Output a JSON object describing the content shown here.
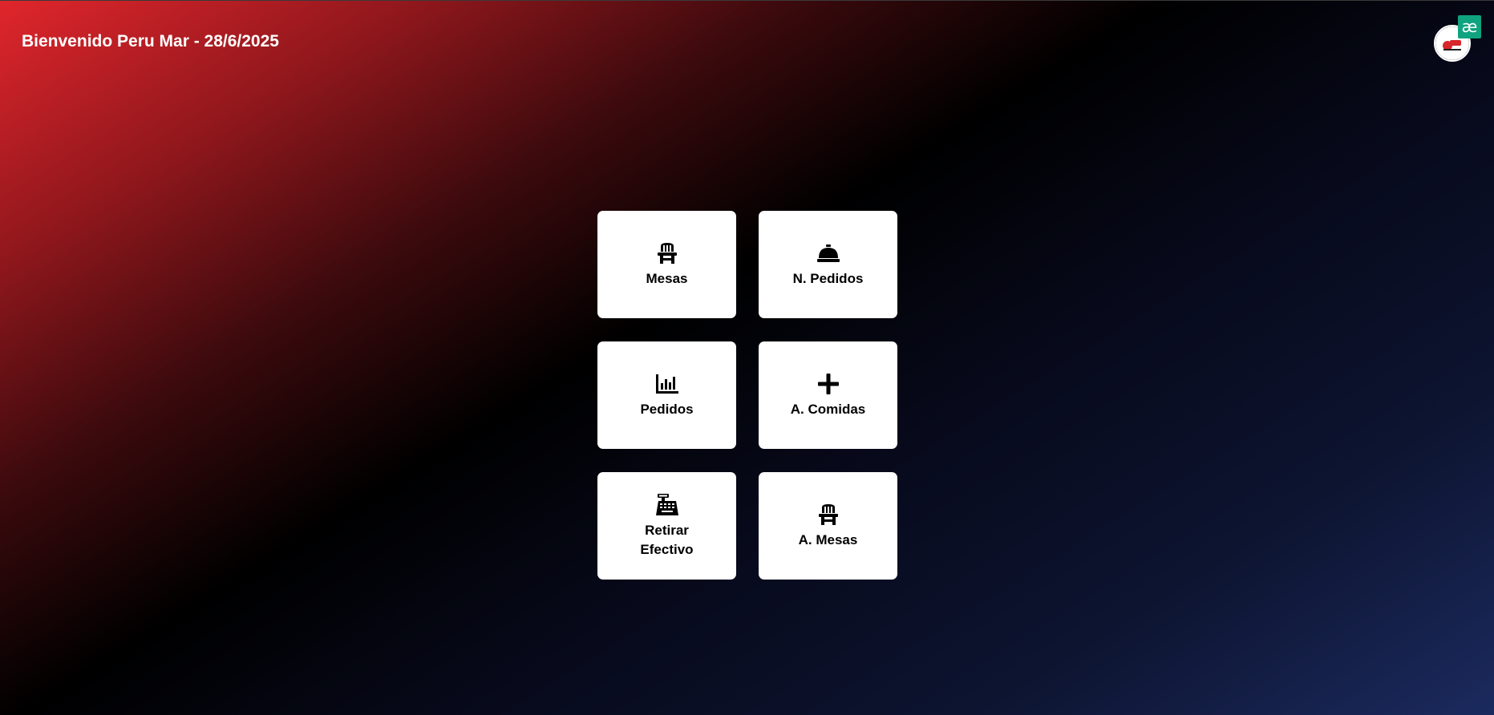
{
  "header": {
    "welcome_text": "Bienvenido Peru Mar - 28/6/2025"
  },
  "extension_badge": {
    "glyph": "æ",
    "color": "#10a37f"
  },
  "menu": {
    "tiles": [
      {
        "label": "Mesas",
        "icon": "chair-icon"
      },
      {
        "label": "N. Pedidos",
        "icon": "service-bell-icon"
      },
      {
        "label": "Pedidos",
        "icon": "bar-chart-icon"
      },
      {
        "label": "A. Comidas",
        "icon": "plus-icon"
      },
      {
        "label": "Retirar Efectivo",
        "icon": "cash-register-icon"
      },
      {
        "label": "A. Mesas",
        "icon": "chair-icon"
      }
    ]
  },
  "colors": {
    "gradient_start": "#e0262c",
    "gradient_mid": "#000000",
    "gradient_end": "#1b2a5e",
    "tile_background": "#ffffff"
  }
}
